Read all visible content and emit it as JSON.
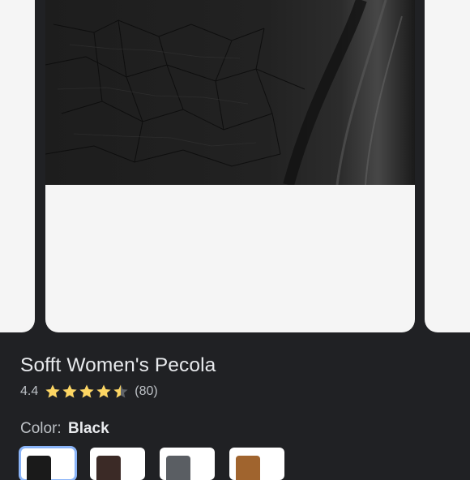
{
  "product": {
    "title": "Sofft Women's Pecola",
    "rating_value": "4.4",
    "rating": 4.4,
    "review_count": "(80)",
    "color_label": "Color:",
    "color_value": "Black"
  },
  "swatches": [
    {
      "name": "black",
      "color": "#1a1a1a",
      "selected": true
    },
    {
      "name": "dark-brown",
      "color": "#3b2a26",
      "selected": false
    },
    {
      "name": "grey",
      "color": "#5a5e63",
      "selected": false
    },
    {
      "name": "cognac",
      "color": "#a0642e",
      "selected": false
    }
  ],
  "colors": {
    "background": "#202124",
    "card": "#f5f5f5",
    "star": "#fdd663",
    "selected_outline": "#8ab4f8"
  }
}
